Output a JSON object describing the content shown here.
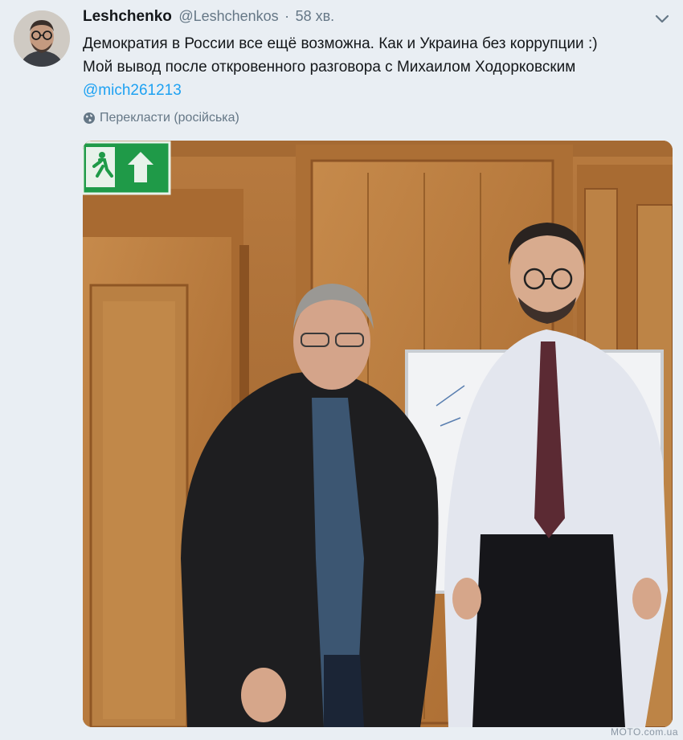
{
  "author": {
    "display_name": "Leshchenko",
    "handle": "@Leshchenkos",
    "separator": "·",
    "time": "58 хв."
  },
  "tweet": {
    "line1": "Демократия в России все ещё возможна. Как и Украина без коррупции :)",
    "line2": "Мой вывод после откровенного разговора с Михаилом Ходорковским",
    "mention": "@mich261213"
  },
  "translate": {
    "label": "Перекласти (російська)",
    "icon": "globe-icon"
  },
  "menu": {
    "icon": "chevron-down-icon"
  },
  "photo": {
    "description_icons": [
      "exit-sign-icon"
    ]
  },
  "watermark": "MOTO.com.ua",
  "colors": {
    "link": "#1da1f2",
    "secondary_text": "#657786",
    "background": "#e9eef3",
    "exit_sign_green": "#1f9a48"
  }
}
